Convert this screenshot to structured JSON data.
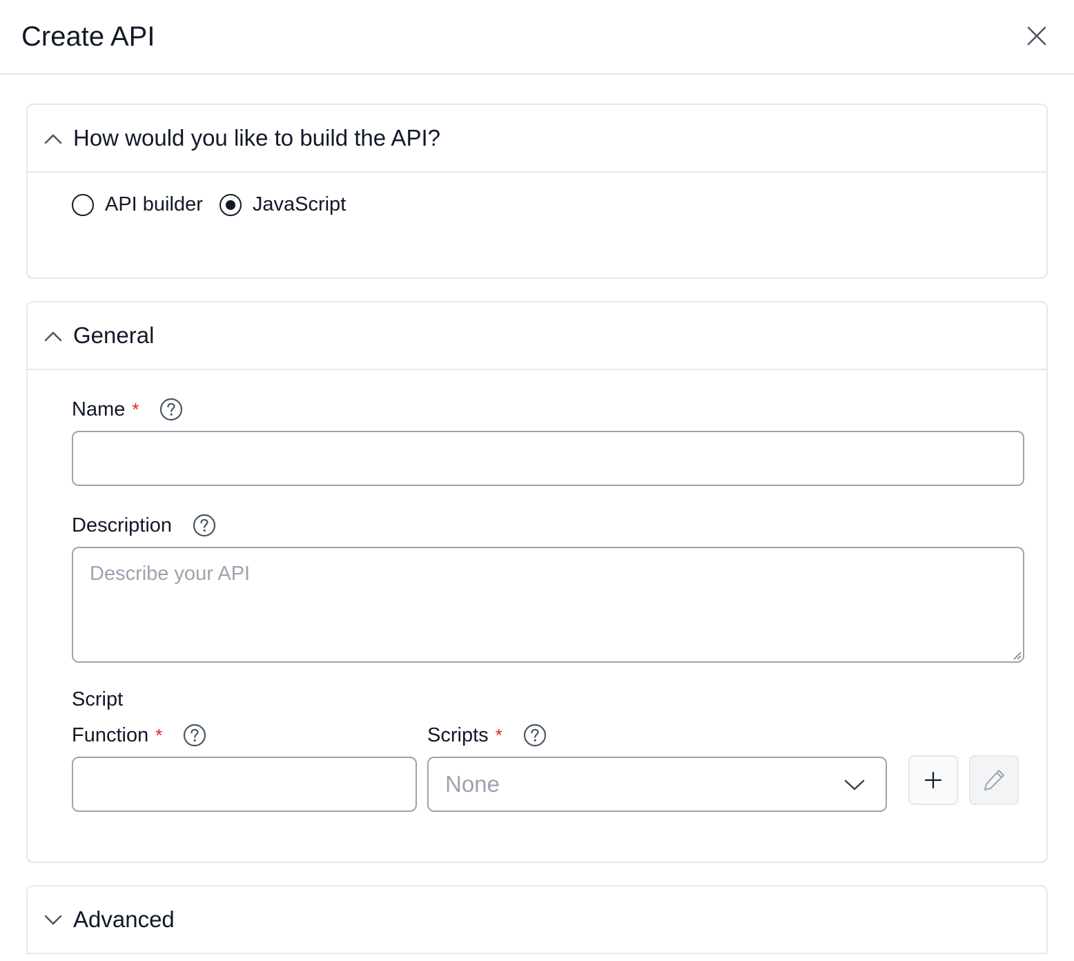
{
  "dialog": {
    "title": "Create API",
    "close_icon": "close-icon"
  },
  "build_section": {
    "title": "How would you like to build the API?",
    "expanded": true,
    "options": [
      {
        "label": "API builder",
        "checked": false
      },
      {
        "label": "JavaScript",
        "checked": true
      }
    ]
  },
  "general_section": {
    "title": "General",
    "expanded": true,
    "name": {
      "label": "Name",
      "required_mark": "*",
      "value": ""
    },
    "description": {
      "label": "Description",
      "placeholder": "Describe your API",
      "value": ""
    },
    "script": {
      "heading": "Script",
      "function": {
        "label": "Function",
        "required_mark": "*",
        "value": ""
      },
      "scripts": {
        "label": "Scripts",
        "required_mark": "*",
        "selected": "None"
      }
    }
  },
  "advanced_section": {
    "title": "Advanced",
    "expanded": false
  },
  "colors": {
    "required": "#dc2626",
    "border": "#9ca3af",
    "panel_border": "#e5e7eb",
    "placeholder": "#9ca3af",
    "text": "#111827"
  }
}
